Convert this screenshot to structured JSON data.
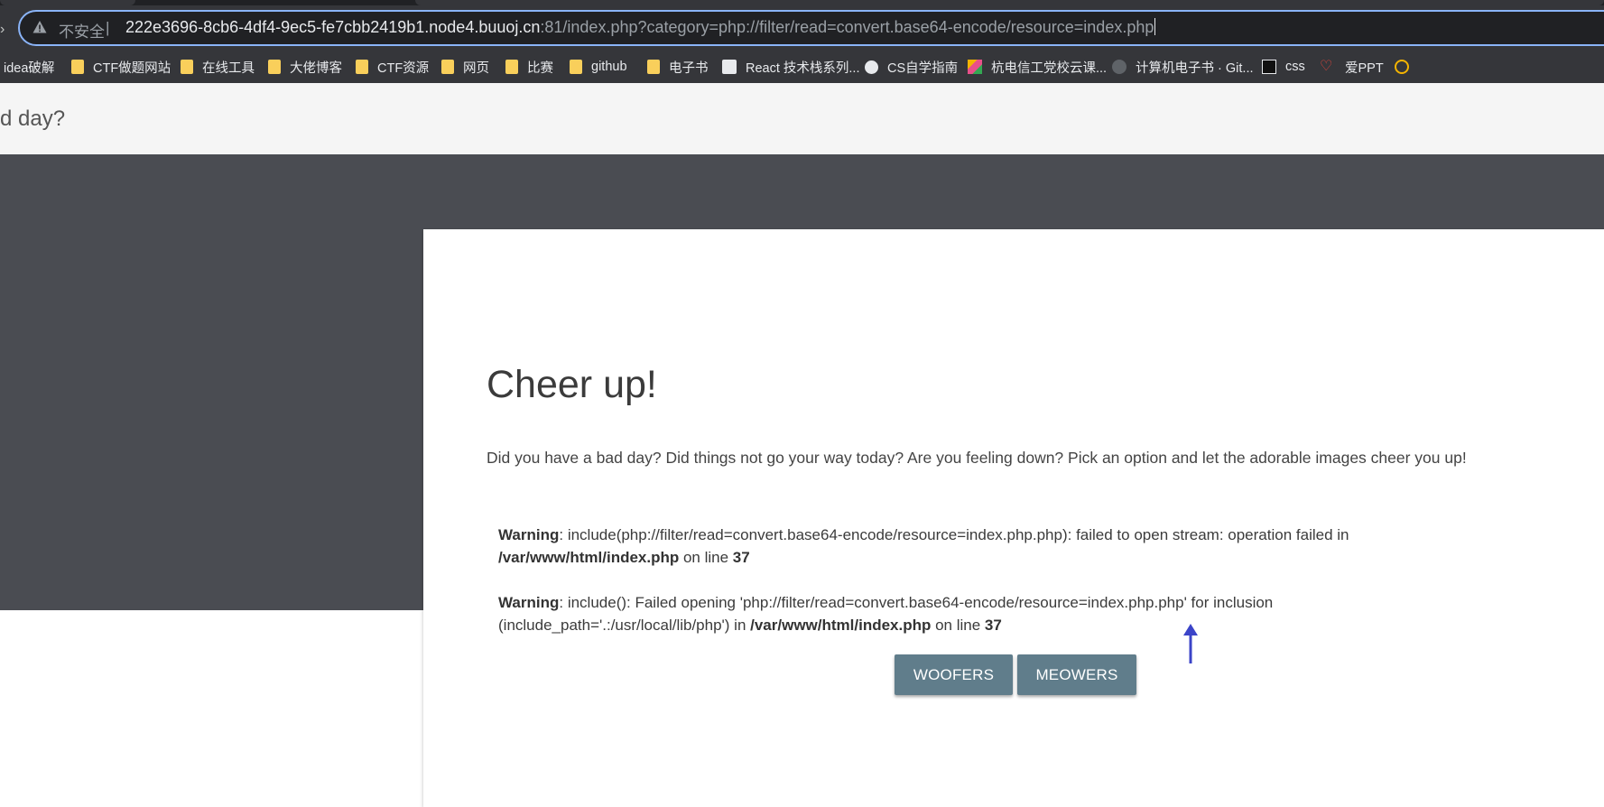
{
  "browser": {
    "security_label": "不安全",
    "separator": "|",
    "url_host": "222e3696-8cb6-4df4-9ec5-fe7cbb2419b1.node4.buuoj.cn",
    "url_rest": ":81/index.php?category=php://filter/read=convert.base64-encode/resource=index.php",
    "bookmarks": [
      {
        "label": "idea破解",
        "icon": "none"
      },
      {
        "label": "CTF做题网站",
        "icon": "folder-icon"
      },
      {
        "label": "在线工具",
        "icon": "folder-icon"
      },
      {
        "label": "大佬博客",
        "icon": "folder-icon"
      },
      {
        "label": "CTF资源",
        "icon": "folder-icon"
      },
      {
        "label": "网页",
        "icon": "folder-icon"
      },
      {
        "label": "比赛",
        "icon": "folder-icon"
      },
      {
        "label": "github",
        "icon": "folder-icon"
      },
      {
        "label": "电子书",
        "icon": "folder-icon"
      },
      {
        "label": "React 技术栈系列...",
        "icon": "site-favicon"
      },
      {
        "label": "CS自学指南",
        "icon": "site-favicon"
      },
      {
        "label": "杭电信工党校云课...",
        "icon": "site-favicon"
      },
      {
        "label": "计算机电子书 · Git...",
        "icon": "github-icon"
      },
      {
        "label": "css",
        "icon": "site-favicon"
      },
      {
        "label": "爱PPT",
        "icon": "site-favicon"
      }
    ],
    "accent_color": "#8ab4f8"
  },
  "navbar": {
    "brand": "d day?"
  },
  "card": {
    "title": "Cheer up!",
    "lead": "Did you have a bad day? Did things not go your way today? Are you feeling down? Pick an option and let the adorable images cheer you up!",
    "warning1": {
      "label": "Warning",
      "text": ": include(php://filter/read=convert.base64-encode/resource=index.php.php): failed to open stream: operation failed in",
      "file": "/var/www/html/index.php",
      "on_line": " on line ",
      "line": "37"
    },
    "warning2": {
      "label": "Warning",
      "text": ": include(): Failed opening 'php://filter/read=convert.base64-encode/resource=index.php.php' for inclusion (include_path='.:/usr/local/lib/php') in ",
      "file": "/var/www/html/index.php",
      "on_line": " on line ",
      "line": "37"
    },
    "buttons": {
      "woofers": "WOOFERS",
      "meowers": "MEOWERS"
    },
    "button_color": "#607d8b",
    "hero_color": "#4a4c52"
  }
}
